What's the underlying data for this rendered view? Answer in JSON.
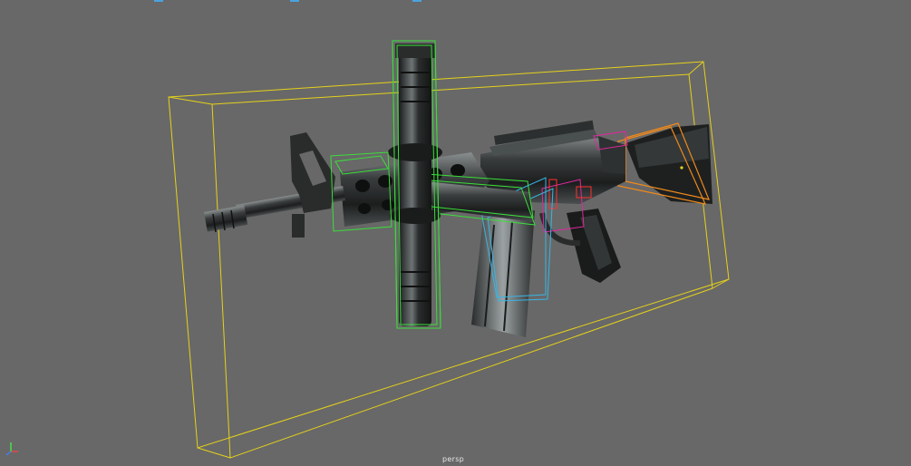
{
  "viewport": {
    "camera_label": "persp"
  },
  "colors": {
    "background": "#686868",
    "bounding_box_main": "#e5d21a",
    "bounding_box_scope": "#3adf3a",
    "bounding_box_magazine": "#36b6e6",
    "bounding_box_stock": "#f08a1a",
    "bounding_box_trigger": "#e0289e",
    "bounding_box_grip": "#ff3030",
    "gun_body": "#2a2c2c",
    "gun_highlight": "#7a7f80"
  },
  "axis_gizmo": {
    "x_color": "#ff4040",
    "y_color": "#40ff40",
    "z_color": "#4080ff"
  },
  "icons": [
    "axis-gizmo-icon"
  ]
}
